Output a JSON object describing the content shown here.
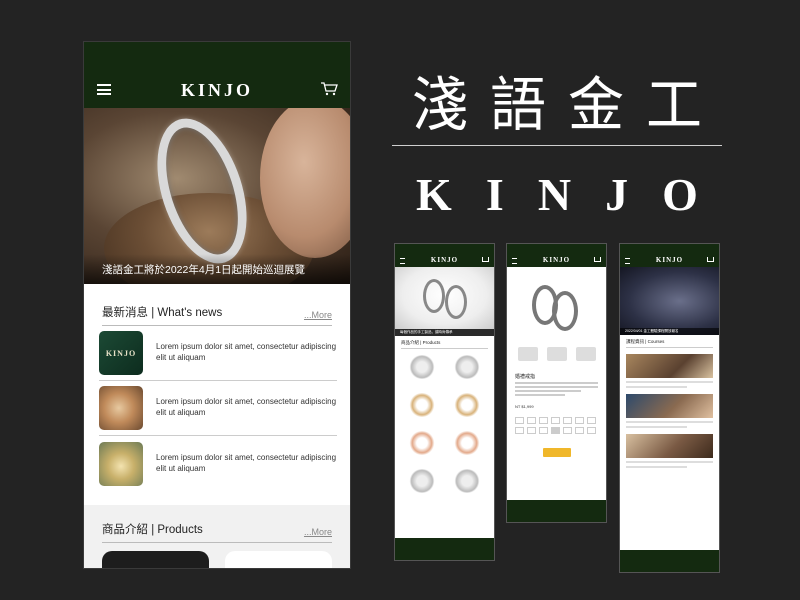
{
  "app": {
    "logo": "KINJO",
    "hero_caption": "淺語金工將於2022年4月1日起開始巡迴展覽"
  },
  "news": {
    "title": "最新消息 | What's news",
    "more": "...More",
    "items": [
      {
        "text": "Lorem ipsum dolor sit amet, consectetur adipiscing elit ut aliquam",
        "thumb_label": "KINJO"
      },
      {
        "text": "Lorem ipsum dolor sit amet, consectetur adipiscing elit ut aliquam"
      },
      {
        "text": "Lorem ipsum dolor sit amet, consectetur adipiscing elit ut aliquam"
      }
    ]
  },
  "products": {
    "title": "商品介紹 | Products",
    "more": "...More"
  },
  "brand": {
    "chinese": [
      "淺",
      "語",
      "金",
      "工"
    ],
    "english": [
      "K",
      "I",
      "N",
      "J",
      "O"
    ]
  },
  "mini_screens": {
    "products_page": {
      "logo": "KINJO",
      "caption": "每個作品的手工製品，讓時尚傳承",
      "section": "商品介紹 | Products"
    },
    "detail_page": {
      "logo": "KINJO",
      "title": "婚禮戒指",
      "price": "NT $1,999"
    },
    "courses_page": {
      "logo": "KINJO",
      "caption": "2022/04/01 金工體驗課程開放報名",
      "section": "課程資訊 | Courses"
    }
  },
  "colors": {
    "background": "#232323",
    "header_green": "#142a10",
    "accent_yellow": "#f0b72a"
  }
}
